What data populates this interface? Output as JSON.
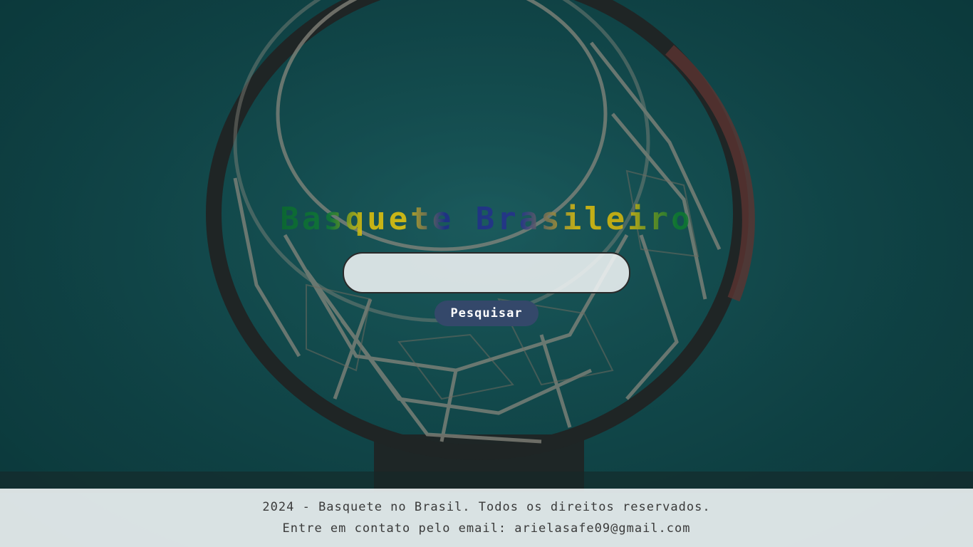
{
  "header": {
    "title": "Basquete Brasileiro"
  },
  "search": {
    "value": "",
    "placeholder": "",
    "button_label": "Pesquisar"
  },
  "footer": {
    "copyright": "2024 - Basquete no Brasil. Todos os direitos reservados.",
    "contact": "Entre em contato pelo email: arielasafe09@gmail.com"
  },
  "colors": {
    "background": "#175a5e",
    "button": "#34486a",
    "title_green": "#0f7a35",
    "title_yellow": "#e4c20a",
    "title_blue": "#27318f"
  }
}
